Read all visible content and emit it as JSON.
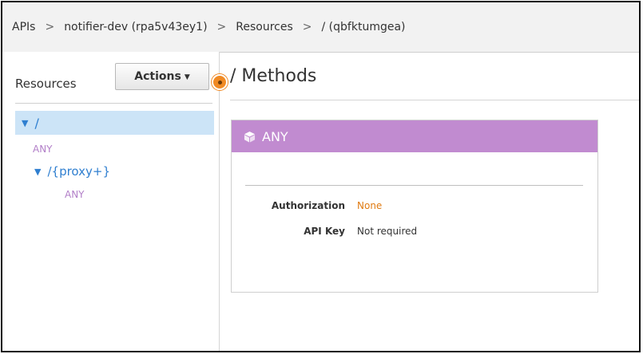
{
  "breadcrumb": {
    "items": [
      "APIs",
      "notifier-dev (rpa5v43ey1)",
      "Resources",
      "/ (qbfktumgea)"
    ],
    "separator": ">"
  },
  "sidebar": {
    "title": "Resources",
    "actions_label": "Actions",
    "tree": {
      "root": {
        "path": "/",
        "method": "ANY"
      },
      "child": {
        "path": "/{proxy+}",
        "method": "ANY"
      }
    }
  },
  "main": {
    "title": "/ Methods",
    "method_card": {
      "method": "ANY",
      "authorization_label": "Authorization",
      "authorization_value": "None",
      "api_key_label": "API Key",
      "api_key_value": "Not required"
    }
  },
  "colors": {
    "breadcrumb_bg": "#f2f2f2",
    "selection_bg": "#cce4f7",
    "link_blue": "#2f7fd0",
    "method_purple": "#c18bd0",
    "method_text": "#b27fc8",
    "accent_orange": "#f08a24"
  },
  "icons": {
    "expand": "triangle-down",
    "method": "cube-icon",
    "step_marker": "orange-dot"
  }
}
